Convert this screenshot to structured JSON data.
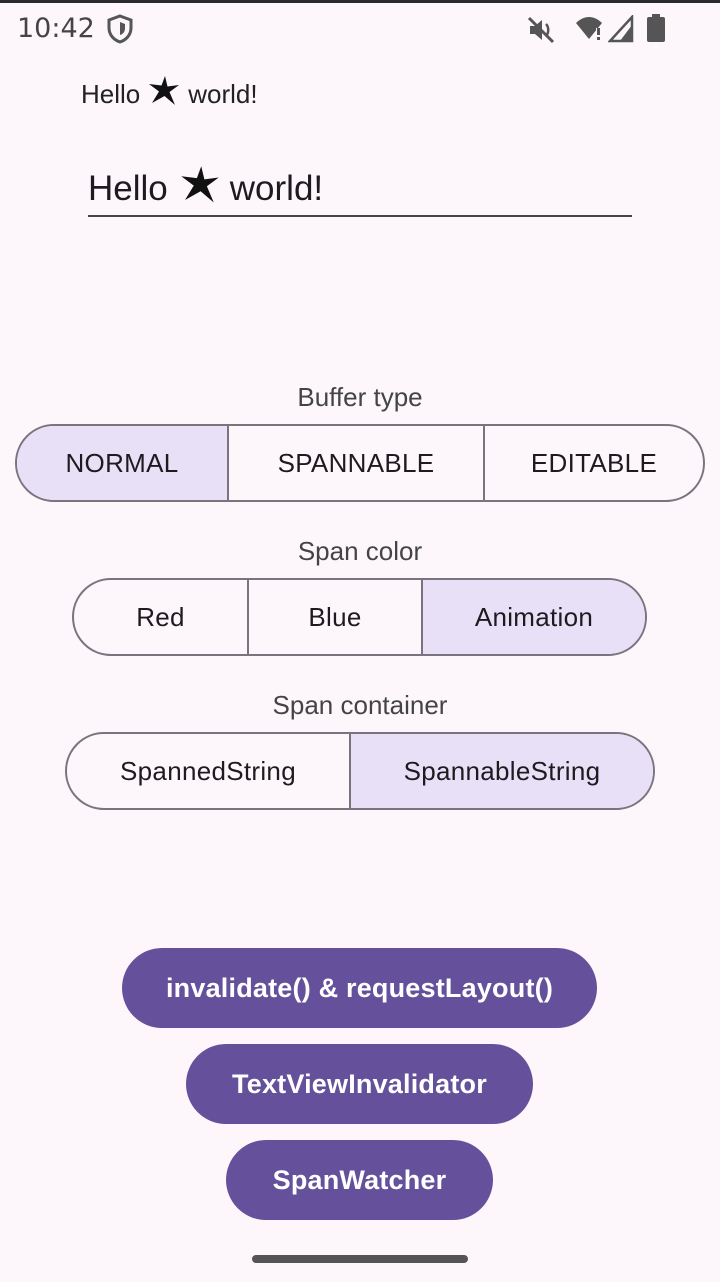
{
  "status_bar": {
    "time": "10:42",
    "icons": [
      "shield-icon",
      "volume-off-icon",
      "wifi-icon",
      "signal-icon",
      "battery-icon"
    ]
  },
  "display_text": {
    "before": "Hello",
    "after": "world!",
    "icon": "star-icon"
  },
  "edit_text": {
    "before": "Hello",
    "after": "world!",
    "icon": "star-icon"
  },
  "buffer_type": {
    "label": "Buffer type",
    "options": [
      "NORMAL",
      "SPANNABLE",
      "EDITABLE"
    ],
    "selected": "NORMAL"
  },
  "span_color": {
    "label": "Span color",
    "options": [
      "Red",
      "Blue",
      "Animation"
    ],
    "selected": "Animation"
  },
  "span_container": {
    "label": "Span container",
    "options": [
      "SpannedString",
      "SpannableString"
    ],
    "selected": "SpannableString"
  },
  "actions": {
    "invalidate": "invalidate() & requestLayout()",
    "invalidator": "TextViewInvalidator",
    "span_watcher": "SpanWatcher"
  },
  "colors": {
    "background": "#fdf7fc",
    "primary": "#65509c",
    "selected_segment": "#e7e0f6",
    "outline": "#79747e"
  }
}
